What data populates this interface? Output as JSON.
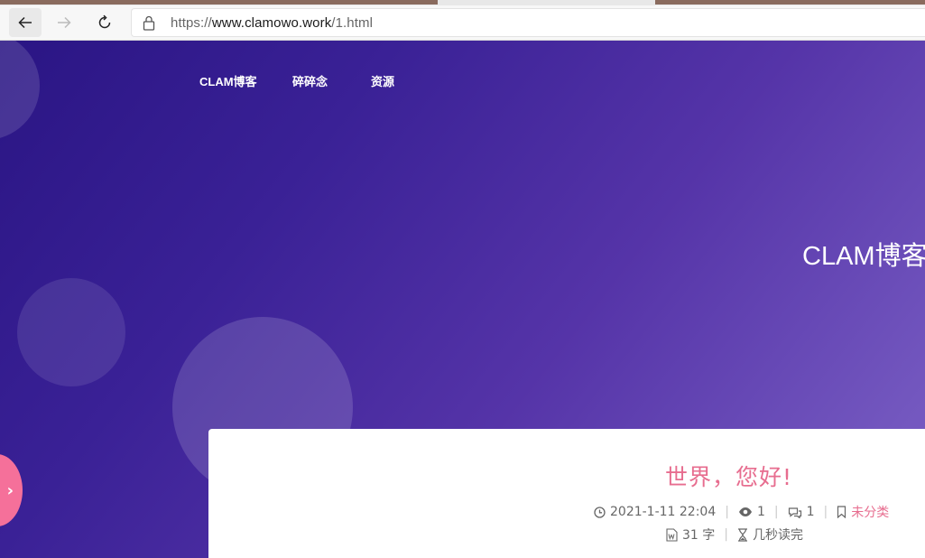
{
  "browser": {
    "url_scheme": "https://",
    "url_host": "www.clamowo.work",
    "url_path": "/1.html"
  },
  "nav": {
    "items": [
      "CLAM博客",
      "碎碎念",
      "资源"
    ]
  },
  "hero": {
    "title": "CLAM博客"
  },
  "post": {
    "title": "世界，您好!",
    "date": "2021-1-11 22:04",
    "views": "1",
    "comments": "1",
    "category": "未分类",
    "words": "31 字",
    "read_time": "几秒读完"
  },
  "colors": {
    "accent": "#e76d8f",
    "hero_start": "#2a1584",
    "hero_end": "#7a5fc4",
    "toggle": "#f5709a"
  },
  "icons": [
    "back-arrow-icon",
    "forward-arrow-icon",
    "reload-icon",
    "lock-icon",
    "clock-icon",
    "eye-icon",
    "comments-icon",
    "bookmark-icon",
    "word-doc-icon",
    "hourglass-icon",
    "chevron-right-icon"
  ]
}
